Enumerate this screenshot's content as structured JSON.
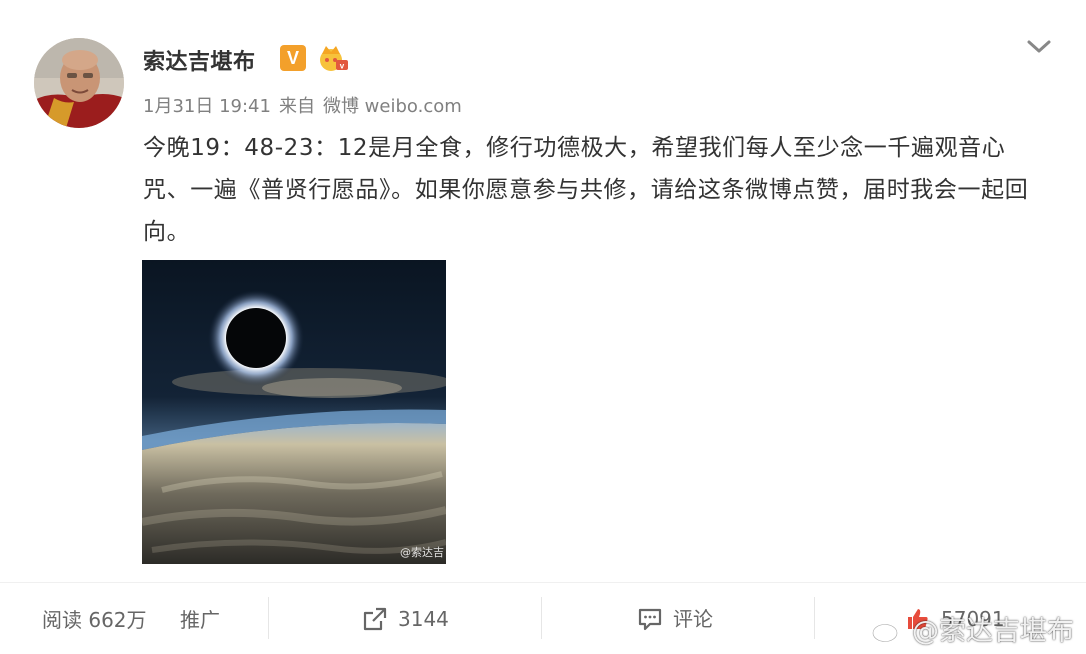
{
  "post": {
    "author": "索达吉堪布",
    "verified_badge": "V",
    "date": "1月31日 19:41",
    "source_prefix": "来自",
    "source": "微博 weibo.com",
    "text": "今晚19：48-23：12是月全食，修行功德极大，希望我们每人至少念一千遍观音心咒、一遍《普贤行愿品》。如果你愿意参与共修，请给这条微博点赞，届时我会一起回向。",
    "image_watermark": "@索达吉"
  },
  "footer": {
    "read_label": "阅读 662万",
    "promote_label": "推广",
    "repost_count": "3144",
    "comment_label": "评论",
    "like_count": "57091",
    "watermark_text": "@索达吉堪布"
  },
  "colors": {
    "badge_orange": "#f3a02b",
    "meta_gray": "#808080",
    "text": "#333333"
  },
  "icons": [
    "avatar",
    "verified-v-icon",
    "crown-badge-icon",
    "chevron-down-icon",
    "repost-icon",
    "comment-icon",
    "like-icon",
    "weibo-logo-icon"
  ]
}
